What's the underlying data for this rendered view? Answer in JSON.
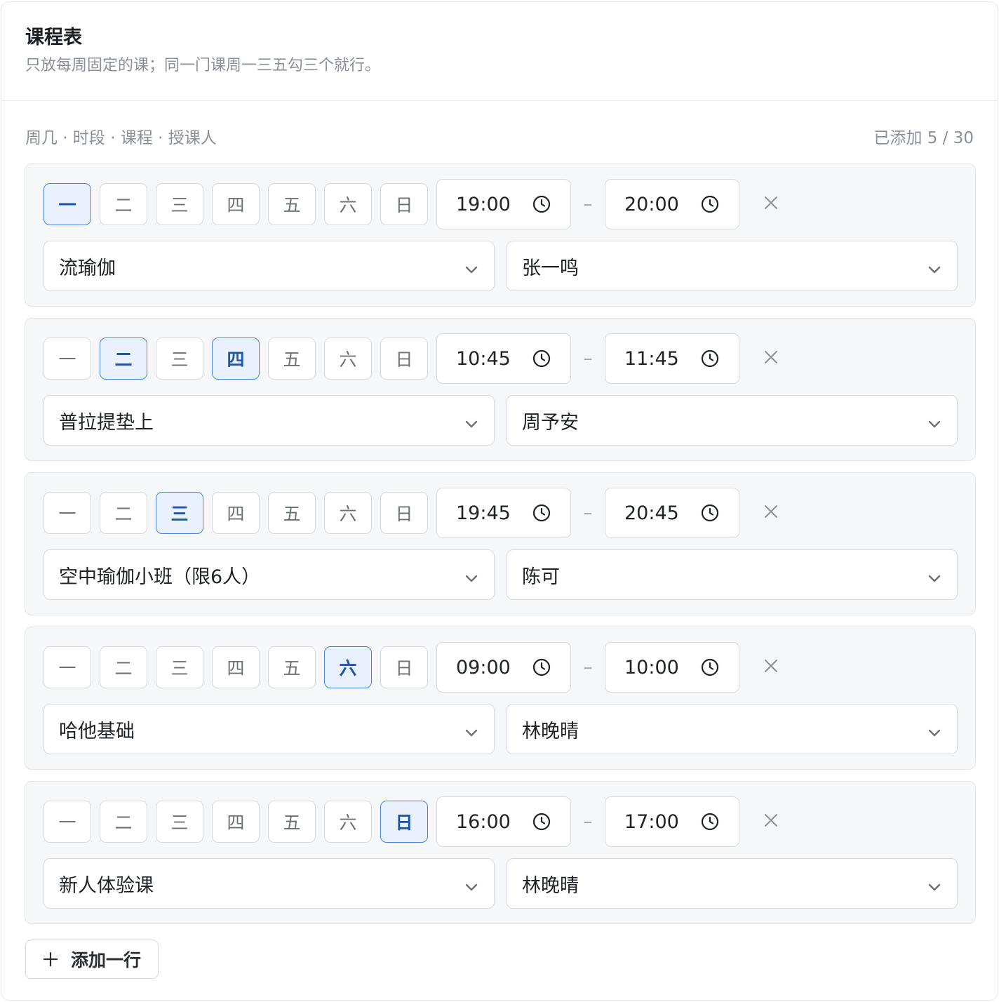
{
  "header": {
    "title": "课程表",
    "subtitle": "只放每周固定的课；同一门课周一三五勾三个就行。"
  },
  "meta": {
    "columns_hint": "周几 · 时段 · 课程 · 授课人",
    "count": "已添加 5 / 30"
  },
  "days": [
    "一",
    "二",
    "三",
    "四",
    "五",
    "六",
    "日"
  ],
  "time_separator": "–",
  "rows": [
    {
      "active_days": [
        0
      ],
      "start": "19:00",
      "end": "20:00",
      "course": "流瑜伽",
      "teacher": "张一鸣"
    },
    {
      "active_days": [
        1,
        3
      ],
      "start": "10:45",
      "end": "11:45",
      "course": "普拉提垫上",
      "teacher": "周予安"
    },
    {
      "active_days": [
        2
      ],
      "start": "19:45",
      "end": "20:45",
      "course": "空中瑜伽小班（限6人）",
      "teacher": "陈可"
    },
    {
      "active_days": [
        5
      ],
      "start": "09:00",
      "end": "10:00",
      "course": "哈他基础",
      "teacher": "林晚晴"
    },
    {
      "active_days": [
        6
      ],
      "start": "16:00",
      "end": "17:00",
      "course": "新人体验课",
      "teacher": "林晚晴"
    }
  ],
  "add_button": {
    "label": "添加一行",
    "icon": "plus-icon"
  },
  "colors": {
    "accent": "#4a83d6",
    "accent_bg": "#e9f1fc",
    "accent_text": "#1d56a8",
    "row_bg": "#f6f7f9",
    "border": "#d6dadf"
  }
}
